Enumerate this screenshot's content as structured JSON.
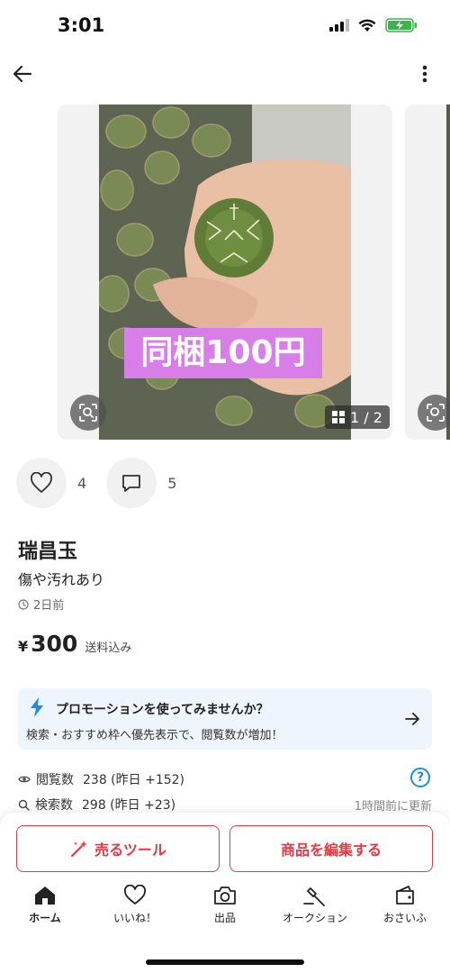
{
  "status_bar": {
    "time": "3:01"
  },
  "photo": {
    "overlay_text": "同梱100円",
    "page_counter": "1 / 2"
  },
  "actions": {
    "likes": "4",
    "comments": "5"
  },
  "item": {
    "title": "瑞昌玉",
    "condition": "傷や汚れあり",
    "posted": "2日前",
    "price_symbol": "¥",
    "price": "300",
    "shipping": "送料込み"
  },
  "promotion": {
    "title": "プロモーションを使ってみませんか？",
    "description": "検索・おすすめ枠へ優先表示で、閲覧数が増加！"
  },
  "stats": {
    "views_label": "閲覧数",
    "views_value": "238 (昨日 +152)",
    "searches_label": "検索数",
    "searches_value": "298 (昨日 +23)",
    "updated": "1時間前に更新",
    "help": "?"
  },
  "bottom_actions": {
    "sell_tool": "売るツール",
    "edit_item": "商品を編集する"
  },
  "tabs": [
    {
      "label": "ホーム",
      "icon": "home-icon",
      "active": true
    },
    {
      "label": "いいね！",
      "icon": "heart-icon"
    },
    {
      "label": "出品",
      "icon": "camera-icon"
    },
    {
      "label": "オークション",
      "icon": "gavel-icon"
    },
    {
      "label": "おさいふ",
      "icon": "wallet-icon"
    }
  ],
  "colors": {
    "accent": "#e8363f",
    "promo_bg": "#eef5fc",
    "promo_bolt": "#1a8fe0",
    "overlay_label": "#d87ee8"
  }
}
